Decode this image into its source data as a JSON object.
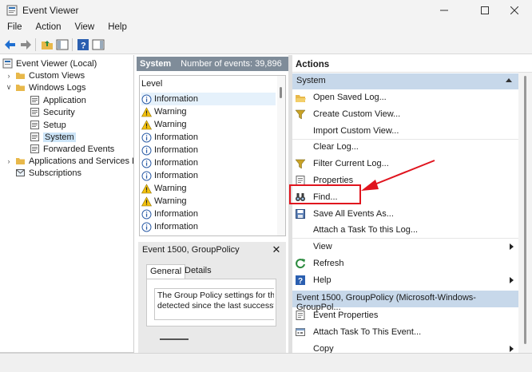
{
  "window": {
    "title": "Event Viewer"
  },
  "menu": [
    "File",
    "Action",
    "View",
    "Help"
  ],
  "tree": {
    "items": [
      {
        "label": "Event Viewer (Local)",
        "level": 0,
        "expanded": true,
        "icon": "event-viewer-icon"
      },
      {
        "label": "Custom Views",
        "level": 1,
        "expanded": false,
        "icon": "folder-icon"
      },
      {
        "label": "Windows Logs",
        "level": 1,
        "expanded": true,
        "icon": "folder-icon"
      },
      {
        "label": "Application",
        "level": 2,
        "icon": "log-icon"
      },
      {
        "label": "Security",
        "level": 2,
        "icon": "log-icon"
      },
      {
        "label": "Setup",
        "level": 2,
        "icon": "log-icon"
      },
      {
        "label": "System",
        "level": 2,
        "icon": "log-icon",
        "selected": true
      },
      {
        "label": "Forwarded Events",
        "level": 2,
        "icon": "log-icon"
      },
      {
        "label": "Applications and Services Lo",
        "level": 1,
        "expanded": false,
        "icon": "folder-icon"
      },
      {
        "label": "Subscriptions",
        "level": 1,
        "icon": "subscriptions-icon"
      }
    ]
  },
  "events": {
    "log_name": "System",
    "count_label": "Number of events: 39,896",
    "column": "Level",
    "rows": [
      {
        "level": "Information",
        "type": "info"
      },
      {
        "level": "Warning",
        "type": "warning"
      },
      {
        "level": "Warning",
        "type": "warning"
      },
      {
        "level": "Information",
        "type": "info"
      },
      {
        "level": "Information",
        "type": "info"
      },
      {
        "level": "Information",
        "type": "info"
      },
      {
        "level": "Information",
        "type": "info"
      },
      {
        "level": "Warning",
        "type": "warning"
      },
      {
        "level": "Warning",
        "type": "warning"
      },
      {
        "level": "Information",
        "type": "info"
      },
      {
        "level": "Information",
        "type": "info"
      }
    ]
  },
  "detail": {
    "title": "Event 1500, GroupPolicy",
    "tabs": [
      "General",
      "Details"
    ],
    "text_line1": "The Group Policy settings for th",
    "text_line2": "detected since the last successf"
  },
  "actions": {
    "title": "Actions",
    "section1": "System",
    "items1": [
      {
        "label": "Open Saved Log...",
        "icon": "open-folder-icon"
      },
      {
        "label": "Create Custom View...",
        "icon": "funnel-icon"
      },
      {
        "label": "Import Custom View...",
        "icon": ""
      },
      {
        "label": "Clear Log...",
        "icon": ""
      },
      {
        "label": "Filter Current Log...",
        "icon": "funnel-icon"
      },
      {
        "label": "Properties",
        "icon": "properties-icon"
      },
      {
        "label": "Find...",
        "icon": "binoculars-icon"
      },
      {
        "label": "Save All Events As...",
        "icon": "save-icon"
      },
      {
        "label": "Attach a Task To this Log...",
        "icon": ""
      },
      {
        "label": "View",
        "icon": "",
        "submenu": true
      },
      {
        "label": "Refresh",
        "icon": "refresh-icon"
      },
      {
        "label": "Help",
        "icon": "help-icon",
        "submenu": true
      }
    ],
    "section2": "Event 1500, GroupPolicy (Microsoft-Windows-GroupPol...",
    "items2": [
      {
        "label": "Event Properties",
        "icon": "properties-icon"
      },
      {
        "label": "Attach Task To This Event...",
        "icon": "task-icon"
      },
      {
        "label": "Copy",
        "icon": "copy-icon",
        "submenu": true
      }
    ]
  },
  "colors": {
    "accent": "#c7d8ea",
    "highlight": "#e0141e",
    "header": "#7f8c99"
  }
}
